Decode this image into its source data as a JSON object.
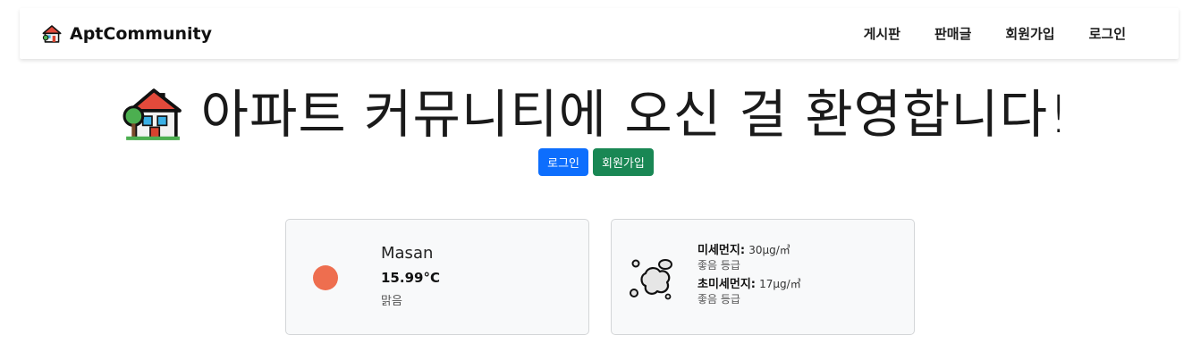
{
  "navbar": {
    "brand": "AptCommunity",
    "links": [
      "게시판",
      "판매글",
      "회원가입",
      "로그인"
    ]
  },
  "hero": {
    "title": "아파트 커뮤니티에 오신 걸 환영합니다!",
    "buttons": {
      "login": "로그인",
      "signup": "회원가입"
    }
  },
  "weather": {
    "city": "Masan",
    "temperature": "15.99°C",
    "description": "맑음",
    "icon": "sun-icon",
    "sun_color": "#ee6e4f"
  },
  "dust": {
    "icon": "dust-cloud-icon",
    "pm10": {
      "label": "미세먼지:",
      "value": "30μg/㎥",
      "grade": "좋음 등급"
    },
    "pm25": {
      "label": "초미세먼지:",
      "value": "17μg/㎥",
      "grade": "좋음 등급"
    }
  },
  "colors": {
    "primary": "#0d6efd",
    "success": "#198754"
  }
}
